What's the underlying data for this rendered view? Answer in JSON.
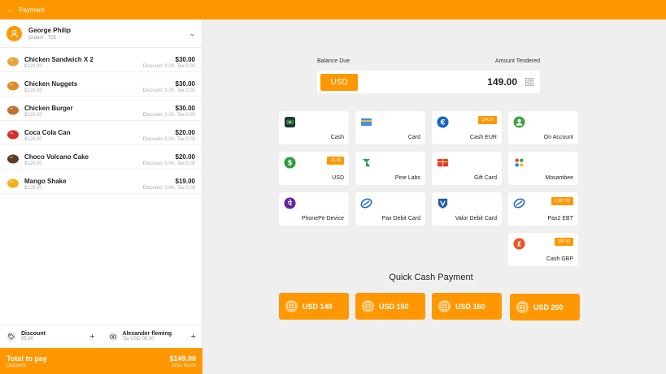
{
  "topbar": {
    "title": "Payment"
  },
  "customer": {
    "name": "George Philip",
    "order": "Order# : T05"
  },
  "items": [
    {
      "name": "Chicken Sandwich X 2",
      "sub": "$120.00",
      "price": "$30.00",
      "discount": "Discount: 0.00, Tax:0.00",
      "icon": "sandwich-icon",
      "color": "#e8a33a"
    },
    {
      "name": "Chicken Nuggets",
      "sub": "$120.00",
      "price": "$30.00",
      "discount": "Discount: 0.00, Tax:0.00",
      "icon": "nuggets-icon",
      "color": "#e3892b"
    },
    {
      "name": "Chicken Burger",
      "sub": "$120.00",
      "price": "$30.00",
      "discount": "Discount: 0.00, Tax:0.00",
      "icon": "burger-icon",
      "color": "#c0702f"
    },
    {
      "name": "Coca Cola Can",
      "sub": "$120.00",
      "price": "$20.00",
      "discount": "Discount: 0.00, Tax:0.00",
      "icon": "soda-can-icon",
      "color": "#d32f2f"
    },
    {
      "name": "Choco Volcano Cake",
      "sub": "$120.00",
      "price": "$20.00",
      "discount": "Discount: 0.00, Tax:0.00",
      "icon": "cake-icon",
      "color": "#5d3a22"
    },
    {
      "name": "Mango Shake",
      "sub": "$120.00",
      "price": "$19.00",
      "discount": "Discount: 0.00, Tax:0.00",
      "icon": "shake-icon",
      "color": "#f2b01e"
    }
  ],
  "discount": {
    "title": "Discount",
    "value": "05.00"
  },
  "tip": {
    "name": "Alexander fleming",
    "value": "Tip USD 05.00"
  },
  "total": {
    "title": "Total to pay",
    "amount": "$149.00",
    "discount_label": "Discount",
    "discount_value": "USD 05.00"
  },
  "balance": {
    "due_label": "Balance Due",
    "tendered_label": "Amount Tendered",
    "currency": "USD",
    "amount": "149.00"
  },
  "methods": [
    {
      "label": "Cash",
      "badge": "",
      "icon": "cash-icon",
      "color": "#2e7d32"
    },
    {
      "label": "Card",
      "badge": "",
      "icon": "card-icon",
      "color": "#4a8fd8"
    },
    {
      "label": "Cash EUR",
      "badge": "124.17",
      "icon": "euro-icon",
      "color": "#1565c0"
    },
    {
      "label": "On Account",
      "badge": "",
      "icon": "account-icon",
      "color": "#43a047"
    },
    {
      "label": "USD",
      "badge": "16.49",
      "icon": "dollar-icon",
      "color": "#2e9d3f"
    },
    {
      "label": "Pine Labs",
      "badge": "",
      "icon": "pine-labs-icon",
      "color": "#2e9d55"
    },
    {
      "label": "Gift Card",
      "badge": "",
      "icon": "gift-card-icon",
      "color": "#e53935"
    },
    {
      "label": "Mosambee",
      "badge": "",
      "icon": "mosambee-icon",
      "color": "#e64a19"
    },
    {
      "label": "PhonePe Device",
      "badge": "",
      "icon": "phonepe-icon",
      "color": "#5f259f"
    },
    {
      "label": "Pax Debit Card",
      "badge": "",
      "icon": "pax-icon",
      "color": "#1565c0"
    },
    {
      "label": "Valor Debit Card",
      "badge": "",
      "icon": "valor-icon",
      "color": "#1e5aa8"
    },
    {
      "label": "Pax2 EBT",
      "badge": "1,397.25",
      "icon": "pax2-icon",
      "color": "#1565c0"
    },
    {
      "label": "Cash GBP",
      "badge": "106.43",
      "icon": "pound-icon",
      "color": "#f4511e"
    }
  ],
  "quick_cash": {
    "title": "Quick Cash Payment",
    "buttons": [
      "USD 149",
      "USD 150",
      "USD 160",
      "USD 200"
    ]
  }
}
